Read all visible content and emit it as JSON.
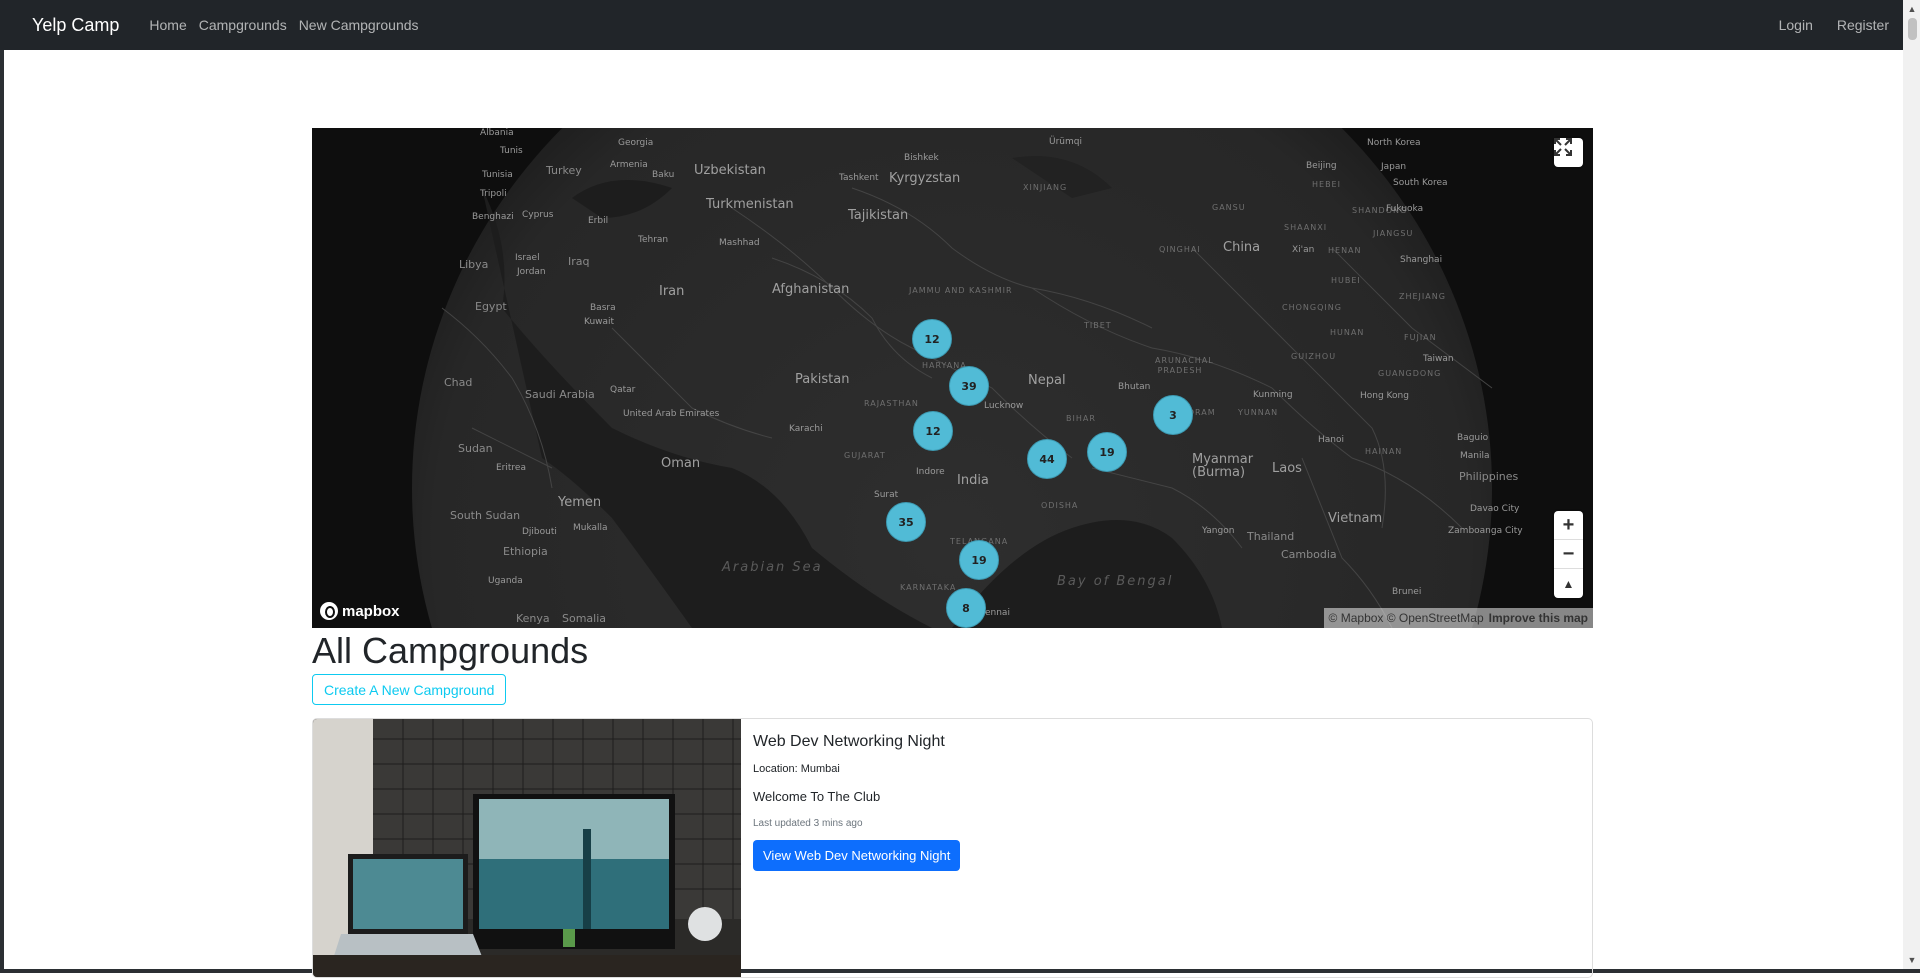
{
  "navbar": {
    "brand": "Yelp Camp",
    "links": [
      "Home",
      "Campgrounds",
      "New Campgrounds"
    ],
    "login": "Login",
    "register": "Register"
  },
  "map": {
    "logo": "mapbox",
    "attribution": "© Mapbox © OpenStreetMap",
    "improve": "Improve this map",
    "zoom_in": "+",
    "zoom_out": "−",
    "compass": "▲",
    "clusters": [
      "12",
      "39",
      "12",
      "3",
      "44",
      "19",
      "35",
      "19",
      "8"
    ],
    "labels": {
      "albania": "Albania",
      "georgia": "Georgia",
      "tunis": "Tunis",
      "tunisia": "Tunisia",
      "turkey": "Turkey",
      "armenia": "Armenia",
      "baku": "Baku",
      "tripoli": "Tripoli",
      "benghazi": "Benghazi",
      "cyprus": "Cyprus",
      "erbil": "Erbil",
      "libya": "Libya",
      "israel": "Israel",
      "jordan": "Jordan",
      "iraq": "Iraq",
      "tehran": "Tehran",
      "mashhad": "Mashhad",
      "uzbekistan": "Uzbekistan",
      "turkmenistan": "Turkmenistan",
      "tashkent": "Tashkent",
      "kyrgyzstan": "Kyrgyzstan",
      "bishkek": "Bishkek",
      "tajikistan": "Tajikistan",
      "urumqi": "Ürümqi",
      "xinjiang": "XINJIANG",
      "egypt": "Egypt",
      "basra": "Basra",
      "kuwait": "Kuwait",
      "iran": "Iran",
      "afghanistan": "Afghanistan",
      "jammu": "JAMMU AND KASHMIR",
      "chad": "Chad",
      "saudi": "Saudi Arabia",
      "qatar": "Qatar",
      "uae": "United Arab Emirates",
      "pakistan": "Pakistan",
      "haryana": "HARYANA",
      "rajasthan": "RAJASTHAN",
      "karachi": "Karachi",
      "lucknow": "Lucknow",
      "nepal": "Nepal",
      "bihar": "BIHAR",
      "bhutan": "Bhutan",
      "sudan": "Sudan",
      "eritrea": "Eritrea",
      "oman": "Oman",
      "gujarat": "GUJARAT",
      "indore": "Indore",
      "india": "India",
      "odisha": "ODISHA",
      "surat": "Surat",
      "yemen": "Yemen",
      "south_sudan": "South Sudan",
      "djibouti": "Djibouti",
      "mukalla": "Mukalla",
      "ethiopia": "Ethiopia",
      "arabian": "Arabian Sea",
      "telangana": "TELANGANA",
      "karnataka": "KARNATAKA",
      "chennai": "Chennai",
      "bay": "Bay of Bengal",
      "uganda": "Uganda",
      "kenya": "Kenya",
      "somalia": "Somalia",
      "tibet": "TIBET",
      "qinghai": "QINGHAI",
      "gansu": "GANSU",
      "china": "China",
      "arunachal": "ARUNACHAL PRADESH",
      "mizoram": "MIZORAM",
      "myanmar": "Myanmar (Burma)",
      "yunnan": "YUNNAN",
      "kunming": "Kunming",
      "laos": "Laos",
      "hanoi": "Hanoi",
      "hainan": "HAINAN",
      "hongkong": "Hong Kong",
      "guangdong": "GUANGDONG",
      "guizhou": "GUIZHOU",
      "hunan": "HUNAN",
      "fujian": "FUJIAN",
      "taiwan": "Taiwan",
      "zhejiang": "ZHEJIANG",
      "shanghai": "Shanghai",
      "hubei": "HUBEI",
      "chongqing": "CHONGQING",
      "xian": "Xi'an",
      "henan": "HENAN",
      "jiangsu": "JIANGSU",
      "shaanxi": "SHAANXI",
      "shandong": "SHANDONG",
      "hebei": "HEBEI",
      "beijing": "Beijing",
      "north_korea": "North Korea",
      "japan": "Japan",
      "south_korea": "South Korea",
      "fukuoka": "Fukuoka",
      "baguio": "Baguio",
      "manila": "Manila",
      "philippines": "Philippines",
      "davao": "Davao City",
      "zamboanga": "Zamboanga City",
      "vietnam": "Vietnam",
      "cambodia": "Cambodia",
      "thailand": "Thailand",
      "yangon": "Yangon",
      "brunei": "Brunei"
    }
  },
  "main": {
    "title": "All Campgrounds",
    "create_button": "Create A New Campground",
    "card": {
      "title": "Web Dev Networking Night",
      "location": "Location: Mumbai",
      "description": "Welcome To The Club",
      "updated": "Last updated 3 mins ago",
      "view_button": "View Web Dev Networking Night"
    }
  },
  "colors": {
    "navbar": "#212529",
    "cluster": "#51bbd6",
    "primary": "#0d6efd",
    "info": "#0dcaf0"
  }
}
